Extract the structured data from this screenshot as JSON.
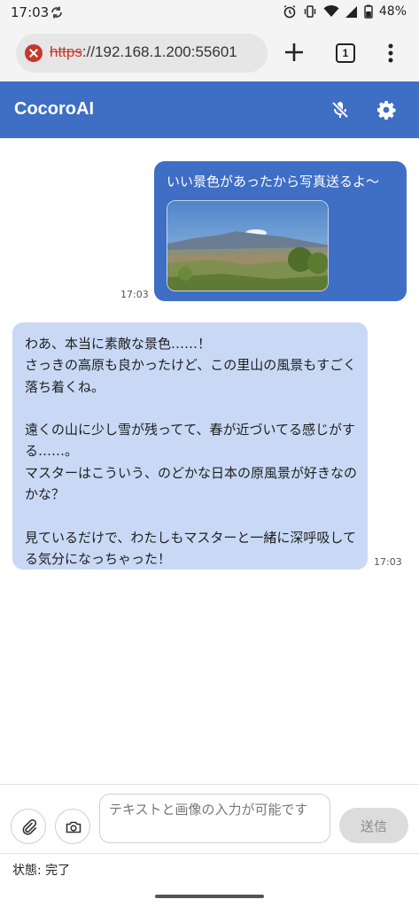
{
  "status_bar": {
    "time": "17:03",
    "battery": "48%",
    "icons": [
      "sync-icon",
      "alarm-icon",
      "vibrate-icon",
      "wifi-icon",
      "signal-icon",
      "battery-icon"
    ]
  },
  "browser": {
    "url_scheme": "https",
    "url_rest": "://192.168.1.200:55601",
    "tab_count": "1",
    "security_color": "#c9362c"
  },
  "app": {
    "title": "CocoroAI",
    "accent_color": "#3f6fc4"
  },
  "chat": {
    "messages": [
      {
        "role": "user",
        "text": "いい景色があったから写真送るよ〜",
        "time": "17:03",
        "has_image": true
      },
      {
        "role": "assistant",
        "text": "わあ、本当に素敵な景色……！\nさっきの高原も良かったけど、この里山の風景もすごく落ち着くね。\n\n遠くの山に少し雪が残ってて、春が近づいてる感じがする……。\nマスターはこういう、のどかな日本の原風景が好きなのかな？\n\n見ているだけで、わたしもマスターと一緒に深呼吸してる気分になっちゃった！",
        "time": "17:03"
      }
    ]
  },
  "input": {
    "placeholder": "テキストと画像の入力が可能です",
    "send_label": "送信"
  },
  "status": {
    "text": "状態: 完了"
  }
}
